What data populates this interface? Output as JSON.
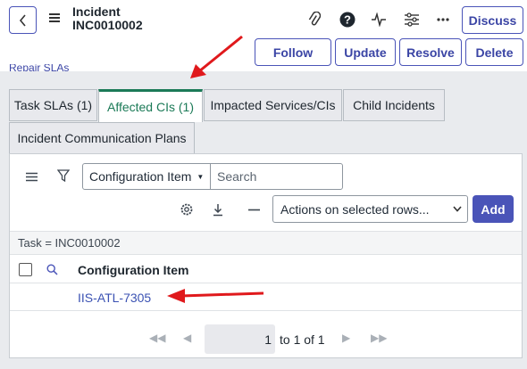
{
  "header": {
    "record_type": "Incident",
    "record_number": "INC0010002",
    "buttons": {
      "discuss": "Discuss",
      "follow": "Follow",
      "update": "Update",
      "resolve": "Resolve",
      "delete": "Delete"
    }
  },
  "partial_link": "Repair SLAs",
  "tabs": [
    {
      "label": "Task SLAs (1)",
      "active": false
    },
    {
      "label": "Affected CIs (1)",
      "active": true
    },
    {
      "label": "Impacted Services/CIs",
      "active": false
    },
    {
      "label": "Child Incidents",
      "active": false
    },
    {
      "label": "Incident Communication Plans",
      "active": false
    }
  ],
  "list": {
    "search_field": "Configuration Item",
    "search_placeholder": "Search",
    "actions_select": "Actions on selected rows...",
    "add_label": "Add",
    "filter": "Task = INC0010002",
    "column_header": "Configuration Item",
    "rows": [
      {
        "configuration_item": "IIS-ATL-7305"
      }
    ],
    "pagination": {
      "page": "1",
      "summary": "to 1 of 1"
    }
  },
  "colors": {
    "accent": "#4a54b8",
    "active_tab": "#1b7a57",
    "link": "#3b52b3",
    "annotation_arrow": "#e0191c"
  }
}
